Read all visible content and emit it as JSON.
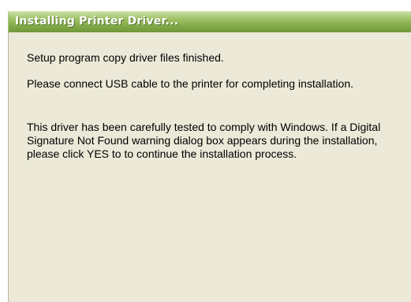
{
  "window": {
    "title": "Installing Printer Driver..."
  },
  "content": {
    "paragraphs": [
      "Setup program copy driver files finished.",
      "Please connect USB cable to the printer for completing installation.",
      "This driver has been carefully tested to comply with Windows. If a Digital Signature Not Found warning dialog box appears during the installation, please click YES to to continue the installation process."
    ]
  },
  "colors": {
    "title_bar": "#86ad4c",
    "title_text": "#ffffff",
    "panel_background": "#ece9d8"
  }
}
